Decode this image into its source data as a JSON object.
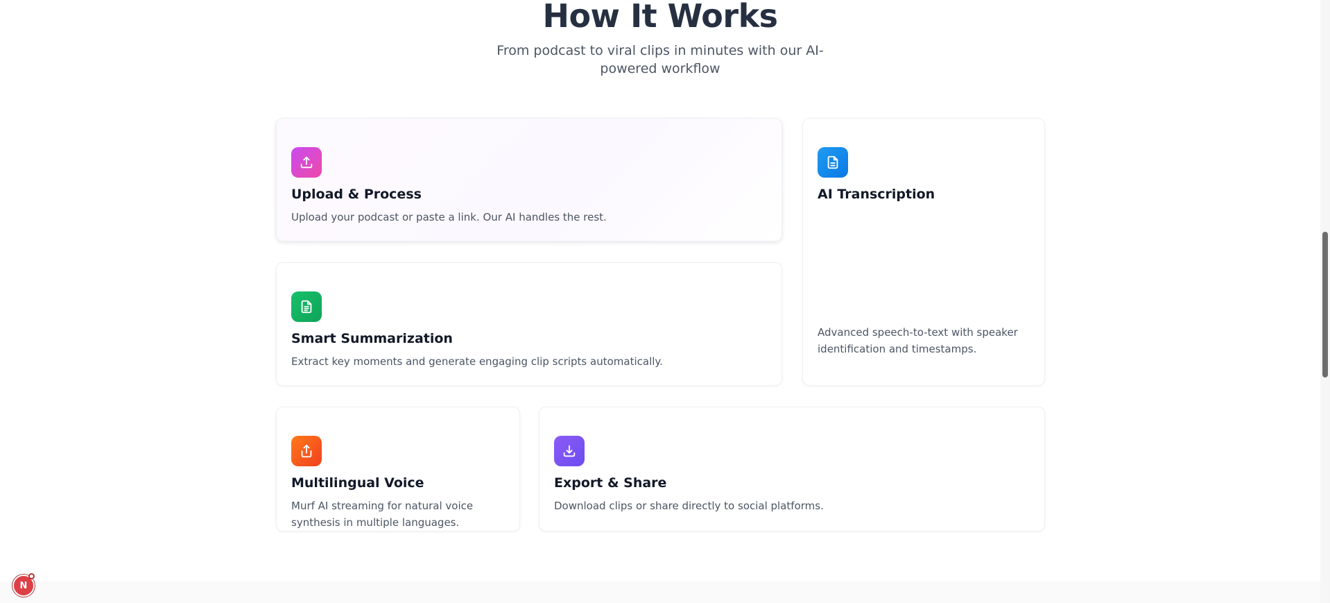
{
  "section": {
    "title": "How It Works",
    "subtitle": "From podcast to viral clips in minutes with our AI-powered workflow"
  },
  "cards": [
    {
      "title": "Upload & Process",
      "description": "Upload your podcast or paste a link. Our AI handles the rest.",
      "icon": "upload-icon",
      "gradient": [
        "#c84bf0",
        "#ee4aa8"
      ]
    },
    {
      "title": "AI Transcription",
      "description": "Advanced speech-to-text with speaker identification and timestamps.",
      "icon": "document-icon",
      "gradient": [
        "#1f9bf0",
        "#0a79e6"
      ]
    },
    {
      "title": "Smart Summarization",
      "description": "Extract key moments and generate engaging clip scripts automatically.",
      "icon": "document-text-icon",
      "gradient": [
        "#18c06a",
        "#0fa35a"
      ]
    },
    {
      "title": "Multilingual Voice",
      "description": "Murf AI streaming for natural voice synthesis in multiple languages.",
      "icon": "share-icon",
      "gradient": [
        "#ff7a1a",
        "#f0401f"
      ]
    },
    {
      "title": "Export & Share",
      "description": "Download clips or share directly to social platforms.",
      "icon": "download-icon",
      "gradient": [
        "#8b5cf6",
        "#6d4cf0"
      ]
    }
  ],
  "dev_indicator": {
    "label": "N"
  }
}
